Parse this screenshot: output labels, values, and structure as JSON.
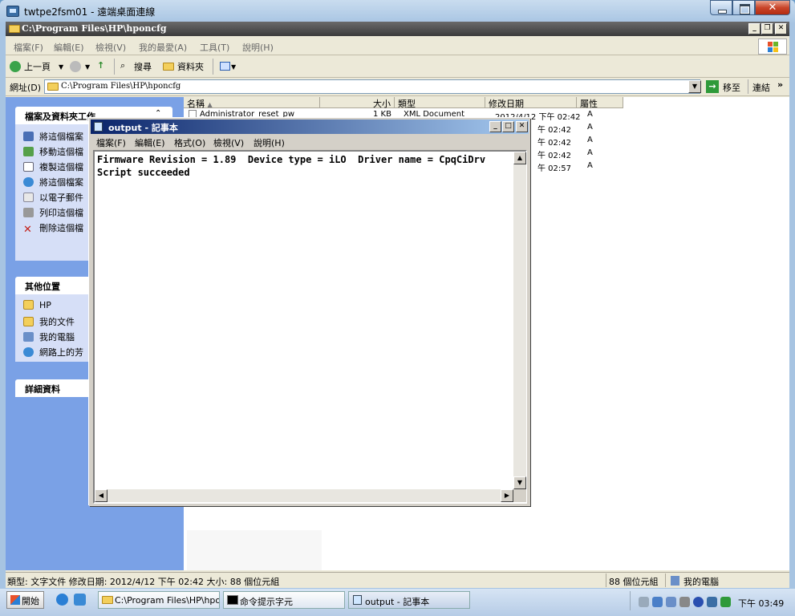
{
  "rdp": {
    "title": "twtpe2fsm01 - 遠端桌面連線"
  },
  "explorer": {
    "title": "C:\\Program Files\\HP\\hponcfg",
    "menu": [
      "檔案(F)",
      "編輯(E)",
      "檢視(V)",
      "我的最愛(A)",
      "工具(T)",
      "說明(H)"
    ],
    "toolbar": {
      "back": "上一頁",
      "search": "搜尋",
      "folders": "資料夾"
    },
    "address": {
      "label": "網址(D)",
      "value": "C:\\Program Files\\HP\\hponcfg",
      "go": "移至",
      "links": "連結",
      "more": "»"
    },
    "tasks": {
      "header": "檔案及資料夾工作",
      "items": [
        "將這個檔案",
        "移動這個檔",
        "複製這個檔",
        "將這個檔案",
        "以電子郵件",
        "列印這個檔",
        "刪除這個檔"
      ]
    },
    "other_places": {
      "header": "其他位置",
      "items": [
        "HP",
        "我的文件",
        "我的電腦",
        "網路上的芳"
      ]
    },
    "details": {
      "header": "詳細資料"
    },
    "columns": {
      "name": "名稱",
      "size": "大小",
      "type": "類型",
      "modified": "修改日期",
      "attr": "屬性"
    },
    "files": [
      {
        "name": "Administrator_reset_pw",
        "size": "1 KB",
        "type": "XML Document",
        "modified": "2012/4/12 下午 02:42",
        "attr": "A"
      },
      {
        "modified": "午 02:42",
        "attr": "A"
      },
      {
        "modified": "午 02:42",
        "attr": "A"
      },
      {
        "modified": "午 02:42",
        "attr": "A"
      },
      {
        "modified": "午 02:57",
        "attr": "A"
      }
    ],
    "status": {
      "left": "類型: 文字文件 修改日期: 2012/4/12 下午 02:42 大小: 88 個位元組",
      "size": "88 個位元組",
      "location": "我的電腦"
    }
  },
  "notepad": {
    "title": "output - 記事本",
    "menu": [
      "檔案(F)",
      "編輯(E)",
      "格式(O)",
      "檢視(V)",
      "說明(H)"
    ],
    "lines": [
      "Firmware Revision = 1.89  Device type = iLO  Driver name = CpqCiDrv",
      "Script succeeded"
    ]
  },
  "taskbar": {
    "start": "開始",
    "buttons": [
      "C:\\Program Files\\HP\\hpon...",
      "命令提示字元",
      "output - 記事本"
    ],
    "clock": "下午 03:49"
  }
}
